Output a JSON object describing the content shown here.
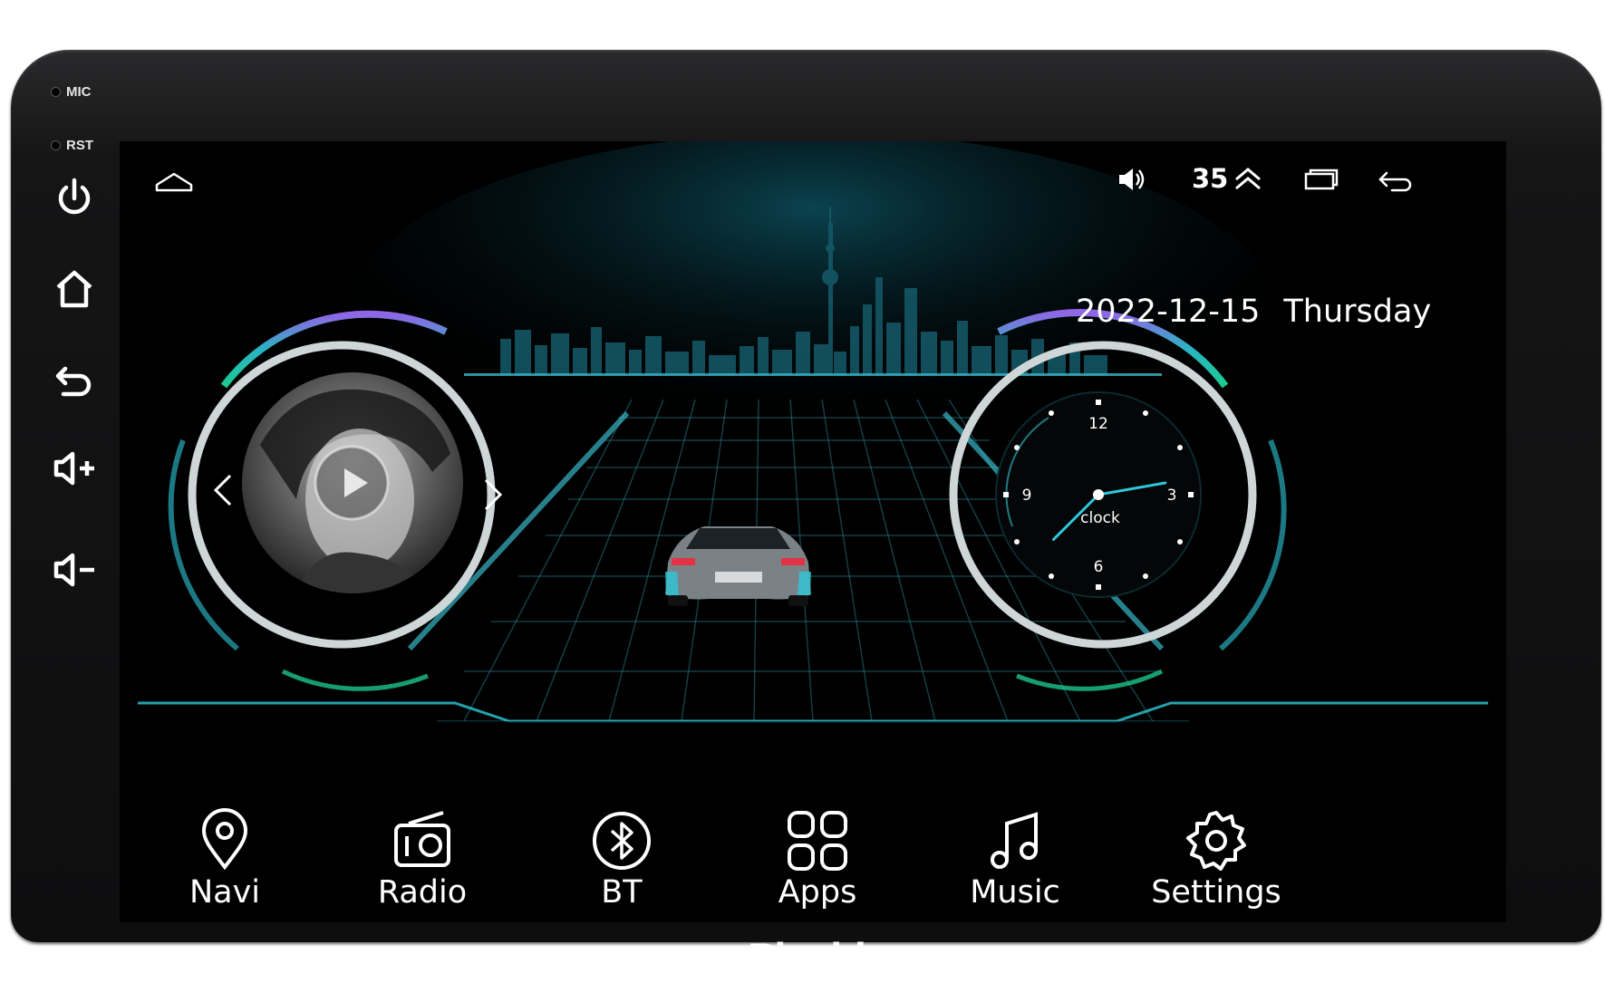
{
  "side_panel": {
    "mic_label": "MIC",
    "rst_label": "RST",
    "buttons": [
      "power-icon",
      "home-icon",
      "back-icon",
      "volume-up-icon",
      "volume-down-icon"
    ]
  },
  "status_bar": {
    "volume_value": "35",
    "icons": [
      "home-icon",
      "speaker-icon",
      "double-chevron-up-icon",
      "recent-apps-icon",
      "back-icon"
    ]
  },
  "datetime": {
    "date": "2022-12-15",
    "day": "Thursday"
  },
  "clock": {
    "label": "clock",
    "numerals": [
      "12",
      "3",
      "6",
      "9"
    ],
    "hour_hand_deg": 225,
    "minute_hand_deg": 80
  },
  "media": {
    "prev_icon": "chevron-left-icon",
    "next_icon": "chevron-right-icon",
    "play_icon": "play-icon"
  },
  "dock": {
    "items": [
      {
        "label": "Navi",
        "icon": "map-pin-icon"
      },
      {
        "label": "Radio",
        "icon": "radio-icon"
      },
      {
        "label": "BT",
        "icon": "bluetooth-icon"
      },
      {
        "label": "Apps",
        "icon": "apps-grid-icon"
      },
      {
        "label": "Music",
        "icon": "music-note-icon"
      },
      {
        "label": "Settings",
        "icon": "gear-icon"
      }
    ]
  },
  "brand": "Pixoid",
  "colors": {
    "accent_teal": "#2ec8d8",
    "accent_purple": "#a060ff",
    "background": "#000000"
  }
}
